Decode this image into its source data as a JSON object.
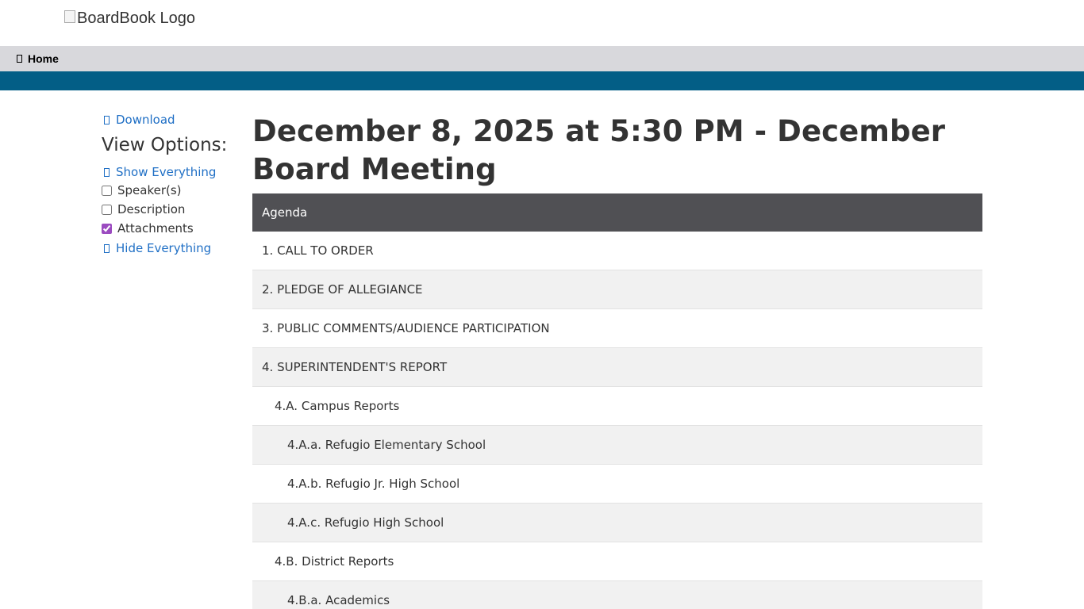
{
  "header": {
    "logo_alt": "BoardBook Logo"
  },
  "nav": {
    "home_label": "Home"
  },
  "sidebar": {
    "download_label": "Download",
    "view_options_heading": "View Options:",
    "show_everything_label": "Show Everything",
    "hide_everything_label": "Hide Everything",
    "options": [
      {
        "label": "Speaker(s)",
        "checked": false
      },
      {
        "label": "Description",
        "checked": false
      },
      {
        "label": "Attachments",
        "checked": true
      }
    ]
  },
  "main": {
    "title": "December 8, 2025 at 5:30 PM - December Board Meeting",
    "agenda_header": "Agenda",
    "agenda_items": [
      {
        "label": "1. CALL TO ORDER",
        "level": 0
      },
      {
        "label": "2. PLEDGE OF ALLEGIANCE",
        "level": 0
      },
      {
        "label": "3. PUBLIC COMMENTS/AUDIENCE PARTICIPATION",
        "level": 0
      },
      {
        "label": "4. SUPERINTENDENT'S REPORT",
        "level": 0
      },
      {
        "label": "4.A. Campus Reports",
        "level": 1
      },
      {
        "label": "4.A.a. Refugio Elementary School",
        "level": 2
      },
      {
        "label": "4.A.b. Refugio Jr. High School",
        "level": 2
      },
      {
        "label": "4.A.c. Refugio High School",
        "level": 2
      },
      {
        "label": "4.B. District Reports",
        "level": 1
      },
      {
        "label": "4.B.a. Academics",
        "level": 2
      }
    ]
  },
  "colors": {
    "accent_band": "#035e86",
    "nav_bg": "#d8d8dc",
    "agenda_header_bg": "#505054",
    "link": "#1f6fc5",
    "checkbox_accent": "#9b4bc0"
  }
}
